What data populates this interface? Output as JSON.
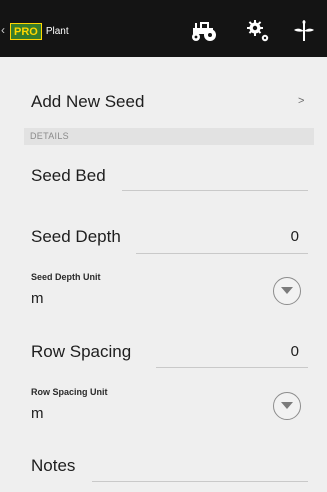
{
  "appbar": {
    "back_glyph": "‹",
    "logo_pro": "PRO",
    "logo_plant": "Plant",
    "icons": [
      "tractor-icon",
      "gear-icon",
      "plant-sprout-icon"
    ]
  },
  "add_seed": {
    "label": "Add New Seed",
    "chevron": ">"
  },
  "section": {
    "details": "DETAILS"
  },
  "fields": {
    "seed_bed": {
      "label": "Seed Bed",
      "value": ""
    },
    "seed_depth": {
      "label": "Seed Depth",
      "value": "0"
    },
    "seed_depth_unit": {
      "label": "Seed Depth Unit",
      "value": "m"
    },
    "row_spacing": {
      "label": "Row Spacing",
      "value": "0"
    },
    "row_spacing_unit": {
      "label": "Row Spacing Unit",
      "value": "m"
    },
    "notes": {
      "label": "Notes",
      "value": ""
    }
  },
  "colors": {
    "appbar_bg": "#141414",
    "brand_green": "#367c2b",
    "brand_yellow": "#ffd700",
    "page_bg": "#efefef"
  }
}
